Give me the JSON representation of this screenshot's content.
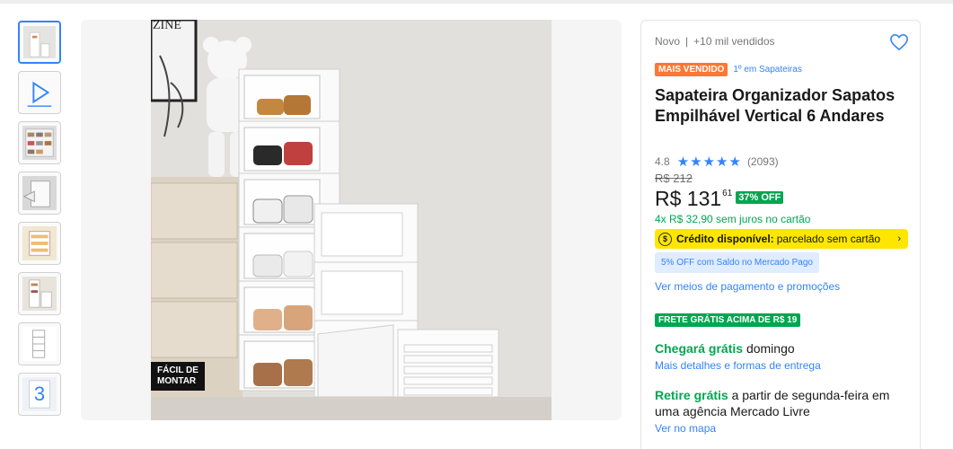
{
  "gallery": {
    "thumbnail_count": 8,
    "more_count": "3",
    "photo_badge": [
      "FÁCIL DE",
      "MONTAR"
    ],
    "photo_text": "ZINE"
  },
  "product": {
    "condition": "Novo",
    "sold": "+10 mil vendidos",
    "badge": "MAIS VENDIDO",
    "rank": "1º em Sapateiras",
    "title": "Sapateira Organizador Sapatos Empilhável Vertical 6 Andares",
    "rating_value": "4.8",
    "stars": "★★★★★",
    "reviews": "(2093)",
    "old_price": "R$ 212",
    "price_main": "R$ 131",
    "price_cents": "61",
    "discount": "37% OFF",
    "installments": "4x R$ 32,90 sem juros no cartão",
    "credit_bold": "Crédito disponível:",
    "credit_rest": "parcelado sem cartão",
    "saldo": "5% OFF com Saldo no Mercado Pago",
    "payment_link": "Ver meios de pagamento e promoções",
    "free_shipping": "FRETE GRÁTIS ACIMA DE R$ 19",
    "arrival_green": "Chegará grátis",
    "arrival_rest": "domingo",
    "delivery_link": "Mais detalhes e formas de entrega",
    "pickup_green": "Retire grátis",
    "pickup_rest": "a partir de segunda-feira em uma agência Mercado Livre",
    "map_link": "Ver no mapa"
  },
  "colors": {
    "accent": "#3483fa",
    "green": "#00a650",
    "orange": "#ff7733",
    "yellow": "#ffe600"
  }
}
